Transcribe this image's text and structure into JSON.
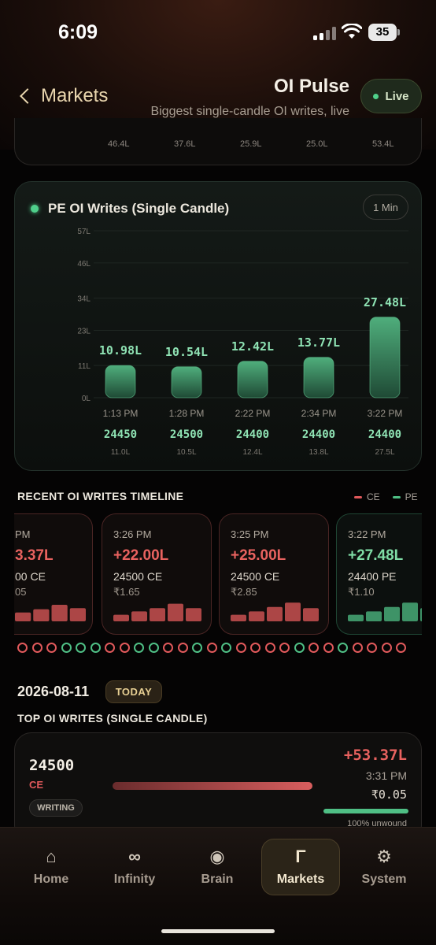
{
  "status_bar": {
    "time": "6:09",
    "battery": "35"
  },
  "header": {
    "back_label": "Markets",
    "title": "OI Pulse",
    "subtitle": "Biggest single-candle OI writes, live",
    "live_label": "Live"
  },
  "prev_card": {
    "values": [
      "46.4L",
      "37.6L",
      "25.9L",
      "25.0L",
      "53.4L"
    ]
  },
  "pe_card": {
    "title": "PE OI Writes (Single Candle)",
    "interval": "1 Min"
  },
  "chart_data": {
    "type": "bar",
    "title": "PE OI Writes (Single Candle)",
    "y_ticks": [
      "57L",
      "46L",
      "34L",
      "23L",
      "11L",
      "0L"
    ],
    "y_tick_values": [
      57,
      46,
      34,
      23,
      11,
      0
    ],
    "ylim": [
      0,
      57
    ],
    "categories": [
      "1:13 PM",
      "1:28 PM",
      "2:22 PM",
      "2:34 PM",
      "3:22 PM"
    ],
    "values": [
      10.98,
      10.54,
      12.42,
      13.77,
      27.48
    ],
    "value_labels": [
      "10.98L",
      "10.54L",
      "12.42L",
      "13.77L",
      "27.48L"
    ],
    "strikes": [
      "24450",
      "24500",
      "24400",
      "24400",
      "24400"
    ],
    "short_values": [
      "11.0L",
      "10.5L",
      "12.4L",
      "13.8L",
      "27.5L"
    ],
    "bar_color": "#3e9a6a",
    "label_color": "#8fe3b4"
  },
  "timeline": {
    "heading": "RECENT OI WRITES TIMELINE",
    "legend_ce": "CE",
    "legend_pe": "PE",
    "ce_color": "#e0595b",
    "pe_color": "#4fbf85",
    "cards": [
      {
        "time": "PM",
        "value": "3.37L",
        "strike": "00 CE",
        "price": "05",
        "side": "CE",
        "bars": [
          0.4,
          0.55,
          0.75,
          0.6
        ]
      },
      {
        "time": "3:26 PM",
        "value": "+22.00L",
        "strike": "24500 CE",
        "price": "₹1.65",
        "side": "CE",
        "bars": [
          0.3,
          0.45,
          0.6,
          0.8,
          0.6
        ]
      },
      {
        "time": "3:25 PM",
        "value": "+25.00L",
        "strike": "24500 CE",
        "price": "₹2.85",
        "side": "CE",
        "bars": [
          0.3,
          0.45,
          0.65,
          0.85,
          0.6
        ]
      },
      {
        "time": "3:22 PM",
        "value": "+27.48L",
        "strike": "24400 PE",
        "price": "₹1.10",
        "side": "PE",
        "bars": [
          0.3,
          0.45,
          0.65,
          0.85,
          0.6
        ]
      }
    ],
    "dots": [
      "CE",
      "CE",
      "CE",
      "PE",
      "PE",
      "PE",
      "CE",
      "CE",
      "PE",
      "PE",
      "CE",
      "CE",
      "PE",
      "CE",
      "PE",
      "CE",
      "CE",
      "CE",
      "CE",
      "PE",
      "CE",
      "CE",
      "PE",
      "CE",
      "CE",
      "CE",
      "CE"
    ]
  },
  "date_row": {
    "date": "2026-08-11",
    "badge": "TODAY"
  },
  "top_writes": {
    "heading": "TOP OI WRITES (SINGLE CANDLE)",
    "item": {
      "strike": "24500",
      "type": "CE",
      "badge": "WRITING",
      "value": "+53.37L",
      "time": "3:31 PM",
      "price": "₹0.05",
      "unwound": "100% unwound"
    }
  },
  "nav": {
    "items": [
      {
        "label": "Home",
        "icon": "home-icon",
        "glyph": "⌂"
      },
      {
        "label": "Infinity",
        "icon": "infinity-icon",
        "glyph": "∞"
      },
      {
        "label": "Brain",
        "icon": "brain-icon",
        "glyph": "◉"
      },
      {
        "label": "Markets",
        "icon": "markets-icon",
        "glyph": "Γ"
      },
      {
        "label": "System",
        "icon": "gear-icon",
        "glyph": "⚙"
      }
    ],
    "active": "Markets"
  }
}
